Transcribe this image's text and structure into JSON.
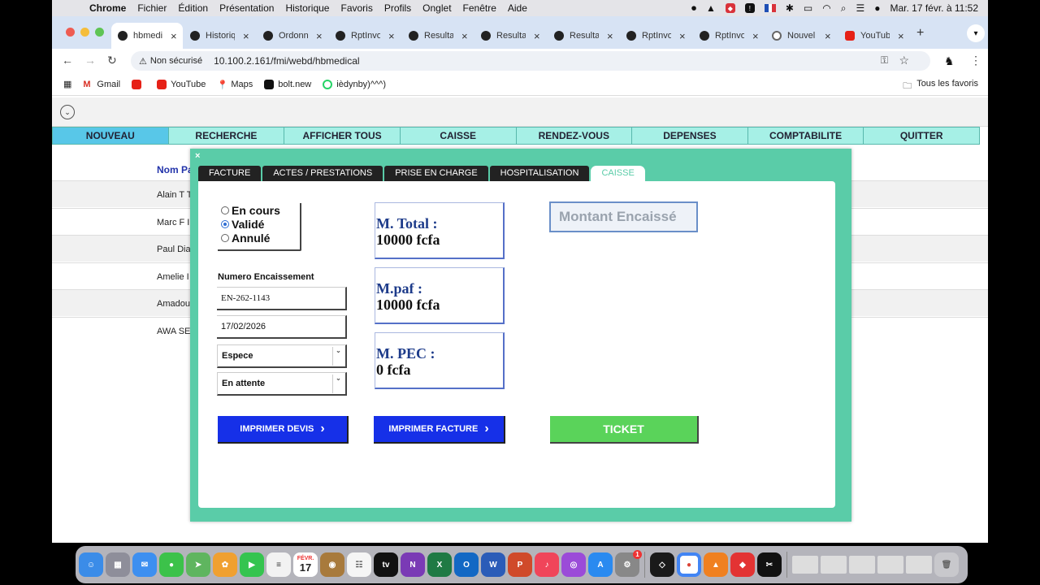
{
  "menubar": {
    "app": "Chrome",
    "items": [
      "Fichier",
      "Édition",
      "Présentation",
      "Historique",
      "Favoris",
      "Profils",
      "Onglet",
      "Fenêtre",
      "Aide"
    ],
    "datetime": "Mar. 17 févr. à 11:52"
  },
  "tabs": [
    {
      "label": "hbmedical",
      "active": true,
      "icon": "site-icon"
    },
    {
      "label": "Historique",
      "icon": "site-icon"
    },
    {
      "label": "Ordonnance",
      "icon": "site-icon"
    },
    {
      "label": "RptInvoice",
      "icon": "site-icon"
    },
    {
      "label": "Resultat",
      "icon": "site-icon"
    },
    {
      "label": "Resultat",
      "icon": "site-icon"
    },
    {
      "label": "Resultat",
      "icon": "site-icon"
    },
    {
      "label": "RptInvoice",
      "icon": "site-icon"
    },
    {
      "label": "RptInvoice",
      "icon": "site-icon"
    },
    {
      "label": "Nouvel onglet",
      "icon": "chrome-icon"
    },
    {
      "label": "YouTube",
      "icon": "youtube-icon"
    }
  ],
  "toolbar": {
    "security": "Non sécurisé",
    "url": "10.100.2.161/fmi/webd/hbmedical"
  },
  "bookmarks": {
    "items": [
      "Gmail",
      "",
      "YouTube",
      "Maps",
      "bolt.new",
      "ièdynby)^^^)"
    ],
    "all": "Tous les favoris"
  },
  "nav": {
    "items": [
      "NOUVEAU",
      "RECHERCHE",
      "AFFICHER TOUS",
      "CAISSE",
      "RENDEZ-VOUS",
      "DEPENSES",
      "COMPTABILITE",
      "QUITTER"
    ]
  },
  "background_list": {
    "header": "Nom Pa",
    "rows": [
      "Alain T T",
      "Marc F I",
      "Paul Dia",
      "Amelie I",
      "Amadou",
      "AWA SE"
    ]
  },
  "modal": {
    "close": "×",
    "tabs": [
      "FACTURE",
      "ACTES / PRESTATIONS",
      "PRISE EN CHARGE",
      "HOSPITALISATION",
      "CAISSE"
    ],
    "status_options": [
      "En cours",
      "Validé",
      "Annulé"
    ],
    "status_selected": 1,
    "numero_label": "Numero Encaissement",
    "numero_value": "EN-262-1143",
    "date_value": "17/02/2026",
    "payment_mode": "Espece",
    "payment_status": "En attente",
    "totals": [
      {
        "label": "M. Total  :",
        "value": "10000 fcfa"
      },
      {
        "label": "M.paf :",
        "value": "10000 fcfa"
      },
      {
        "label": "M. PEC :",
        "value": "0 fcfa"
      }
    ],
    "montant_placeholder": "Montant Encaissé",
    "btn_devis": "IMPRIMER DEVIS",
    "btn_facture": "IMPRIMER FACTURE",
    "btn_ticket": "TICKET"
  },
  "dock": {
    "calendar_month": "FÉVR.",
    "calendar_day": "17"
  }
}
